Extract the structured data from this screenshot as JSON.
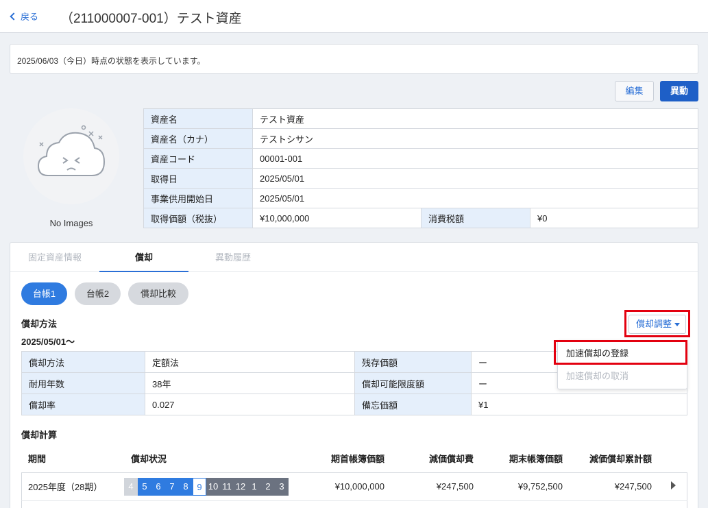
{
  "header": {
    "back_label": "戻る",
    "title": "（211000007-001）テスト資産"
  },
  "notice": "2025/06/03（今日）時点の状態を表示しています。",
  "actions": {
    "edit": "編集",
    "move": "異動"
  },
  "image": {
    "placeholder": "No Images"
  },
  "asset_info": {
    "rows": [
      {
        "label": "資産名",
        "value": "テスト資産"
      },
      {
        "label": "資産名（カナ）",
        "value": "テストシサン"
      },
      {
        "label": "資産コード",
        "value": "00001-001"
      },
      {
        "label": "取得日",
        "value": "2025/05/01"
      },
      {
        "label": "事業供用開始日",
        "value": "2025/05/01"
      }
    ],
    "price_label": "取得価額（税抜）",
    "price_value": "¥10,000,000",
    "tax_label": "消費税額",
    "tax_value": "¥0"
  },
  "tabs": [
    "固定資産情報",
    "償却",
    "異動履歴"
  ],
  "ledger_pills": [
    "台帳1",
    "台帳2",
    "償却比較"
  ],
  "method_section": {
    "title": "償却方法",
    "date": "2025/05/01〜"
  },
  "adjust_button": "償却調整",
  "dropdown": {
    "items": [
      "加速償却の登録",
      "加速償却の取消"
    ]
  },
  "method_table": [
    [
      "償却方法",
      "定額法",
      "残存価額",
      "ー"
    ],
    [
      "耐用年数",
      "38年",
      "償却可能限度額",
      "ー"
    ],
    [
      "償却率",
      "0.027",
      "備忘価額",
      "¥1"
    ]
  ],
  "calc_section": {
    "title": "償却計算"
  },
  "calc_table": {
    "headers": [
      "期間",
      "償却状況",
      "期首帳簿価額",
      "減価償却費",
      "期末帳簿価額",
      "減価償却累計額"
    ],
    "rows": [
      {
        "period": "2025年度（28期）",
        "months": [
          "4",
          "5",
          "6",
          "7",
          "8",
          "9",
          "10",
          "11",
          "12",
          "1",
          "2",
          "3"
        ],
        "opening": "¥10,000,000",
        "depreciation": "¥247,500",
        "closing": "¥9,752,500",
        "accumulated": "¥247,500"
      }
    ]
  }
}
